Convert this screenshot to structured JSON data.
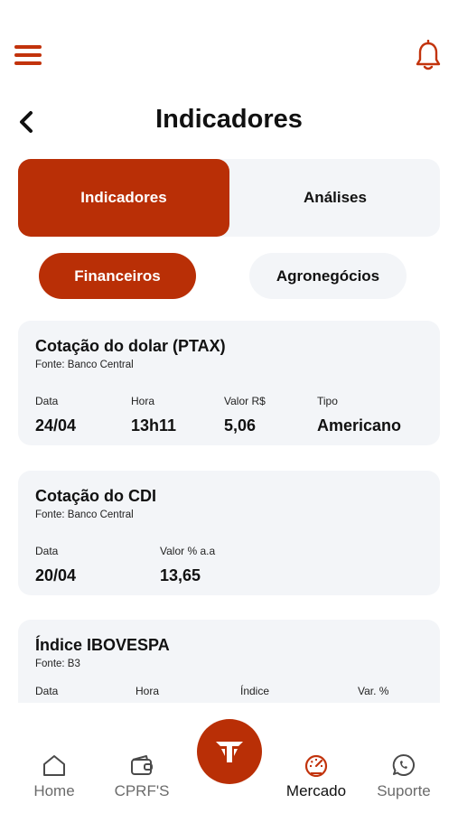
{
  "header": {
    "title": "Indicadores"
  },
  "segments": {
    "active": "Indicadores",
    "inactive": "Análises"
  },
  "pills": {
    "active": "Financeiros",
    "inactive": "Agronegócios"
  },
  "cards": [
    {
      "title": "Cotação do dolar (PTAX)",
      "source": "Fonte: Banco Central",
      "fields": [
        {
          "label": "Data",
          "value": "24/04"
        },
        {
          "label": "Hora",
          "value": "13h11"
        },
        {
          "label": "Valor R$",
          "value": "5,06"
        },
        {
          "label": "Tipo",
          "value": "Americano"
        }
      ]
    },
    {
      "title": "Cotação do CDI",
      "source": "Fonte: Banco Central",
      "fields": [
        {
          "label": "Data",
          "value": "20/04"
        },
        {
          "label": "Valor % a.a",
          "value": "13,65"
        }
      ]
    },
    {
      "title": "Índice IBOVESPA",
      "source": "Fonte: B3",
      "fields": [
        {
          "label": "Data",
          "value": ""
        },
        {
          "label": "Hora",
          "value": ""
        },
        {
          "label": "Índice",
          "value": ""
        },
        {
          "label": "Var. %",
          "value": ""
        }
      ]
    }
  ],
  "nav": {
    "items": [
      {
        "label": "Home",
        "icon": "home-icon"
      },
      {
        "label": "CPRF'S",
        "icon": "wallet-icon"
      },
      {
        "label": "Mercado",
        "icon": "speedometer-icon"
      },
      {
        "label": "Suporte",
        "icon": "whatsapp-icon"
      }
    ],
    "active": "Mercado"
  },
  "colors": {
    "accent": "#b92f06",
    "card_bg": "#f3f5f8",
    "muted": "#6b6b6b"
  }
}
